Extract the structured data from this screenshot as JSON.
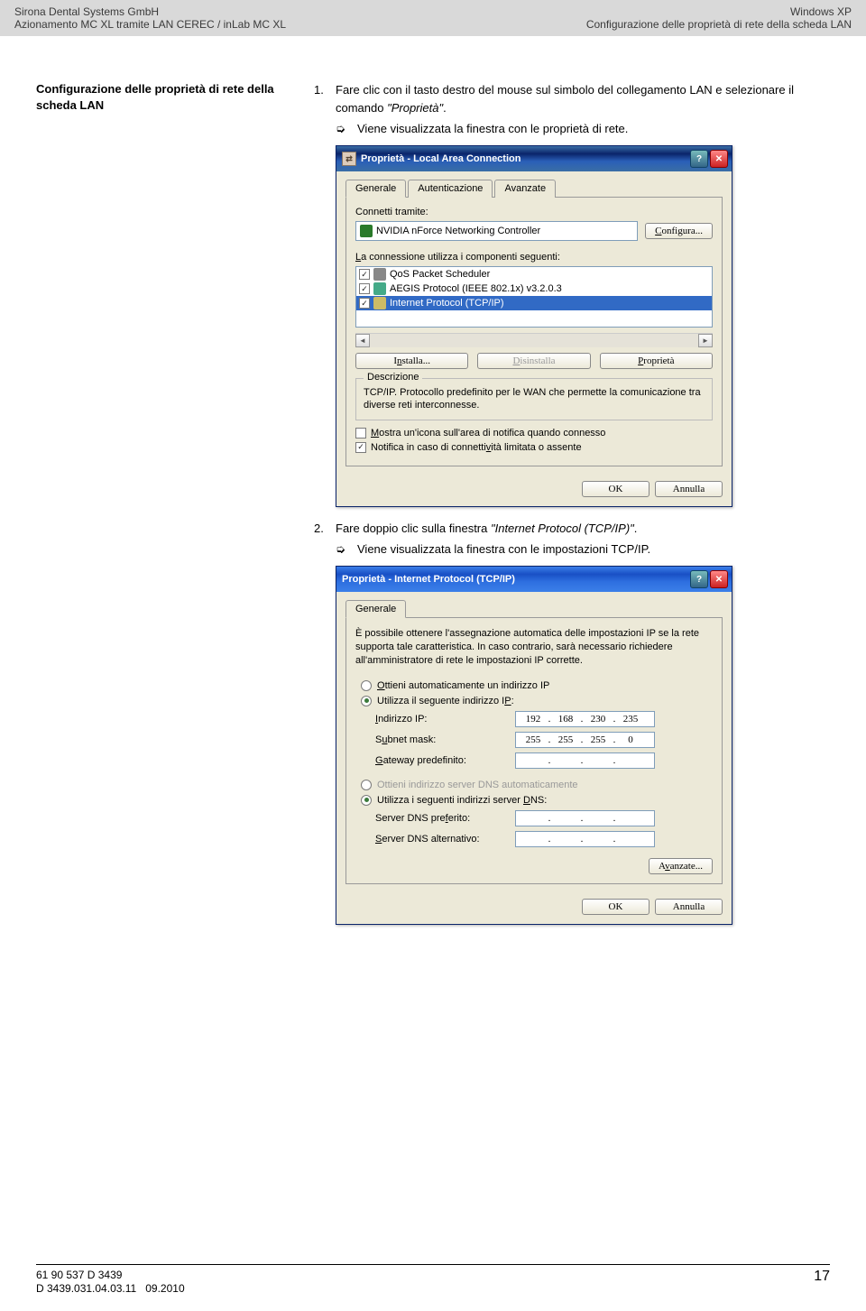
{
  "header": {
    "left_line1": "Sirona Dental Systems GmbH",
    "left_line2": "Azionamento MC XL tramite LAN CEREC / inLab MC XL",
    "right_line1": "Windows XP",
    "right_line2": "Configurazione delle proprietà di rete della scheda LAN"
  },
  "side_heading": "Configurazione delle proprietà di rete della scheda LAN",
  "steps": {
    "s1_num": "1.",
    "s1_text_a": "Fare clic con il tasto destro del mouse sul simbolo del collegamento LAN e selezionare il comando ",
    "s1_text_b": "\"Proprietà\"",
    "s1_text_c": ".",
    "s1_result_icon": "➭",
    "s1_result": "Viene visualizzata la finestra con le proprietà di rete.",
    "s2_num": "2.",
    "s2_text_a": "Fare doppio clic sulla finestra ",
    "s2_text_b": "\"Internet Protocol (TCP/IP)\"",
    "s2_text_c": ".",
    "s2_result_icon": "➭",
    "s2_result": "Viene visualizzata la finestra con le impostazioni TCP/IP."
  },
  "window1": {
    "title": "Proprietà - Local Area Connection",
    "tabs": {
      "generale": "Generale",
      "autenticazione": "Autenticazione",
      "avanzate": "Avanzate"
    },
    "connect_via": "Connetti tramite:",
    "adapter": "NVIDIA nForce Networking Controller",
    "configure": "Configura...",
    "components_label": "La connessione utilizza i componenti seguenti:",
    "components": {
      "c1": "QoS Packet Scheduler",
      "c2": "AEGIS Protocol (IEEE 802.1x) v3.2.0.3",
      "c3": "Internet Protocol (TCP/IP)"
    },
    "install": "Installa...",
    "uninstall": "Disinstalla",
    "properties": "Proprietà",
    "desc_label": "Descrizione",
    "desc_text": "TCP/IP. Protocollo predefinito per le WAN che permette la comunicazione tra diverse reti interconnesse.",
    "show_icon": "Mostra un'icona sull'area di notifica quando connesso",
    "notify": "Notifica in caso di connettività limitata o assente",
    "ok": "OK",
    "cancel": "Annulla"
  },
  "window2": {
    "title": "Proprietà - Internet Protocol (TCP/IP)",
    "tab_generale": "Generale",
    "desc": "È possibile ottenere l'assegnazione automatica delle impostazioni IP se la rete supporta tale caratteristica. In caso contrario, sarà necessario richiedere all'amministratore di rete le impostazioni IP corrette.",
    "radio_auto_ip": "Ottieni automaticamente un indirizzo IP",
    "radio_use_ip": "Utilizza il seguente indirizzo IP:",
    "ip_label": "Indirizzo IP:",
    "ip_value": {
      "a": "192",
      "b": "168",
      "c": "230",
      "d": "235"
    },
    "subnet_label": "Subnet mask:",
    "subnet_value": {
      "a": "255",
      "b": "255",
      "c": "255",
      "d": "0"
    },
    "gateway_label": "Gateway predefinito:",
    "radio_auto_dns": "Ottieni indirizzo server DNS automaticamente",
    "radio_use_dns": "Utilizza i seguenti indirizzi server DNS:",
    "dns1_label": "Server DNS preferito:",
    "dns2_label": "Server DNS alternativo:",
    "advanced": "Avanzate...",
    "ok": "OK",
    "cancel": "Annulla"
  },
  "footer": {
    "line1": "61 90 537 D 3439",
    "line2_a": "D 3439.031.04.03.11",
    "line2_b": "09.2010",
    "page_num": "17"
  }
}
